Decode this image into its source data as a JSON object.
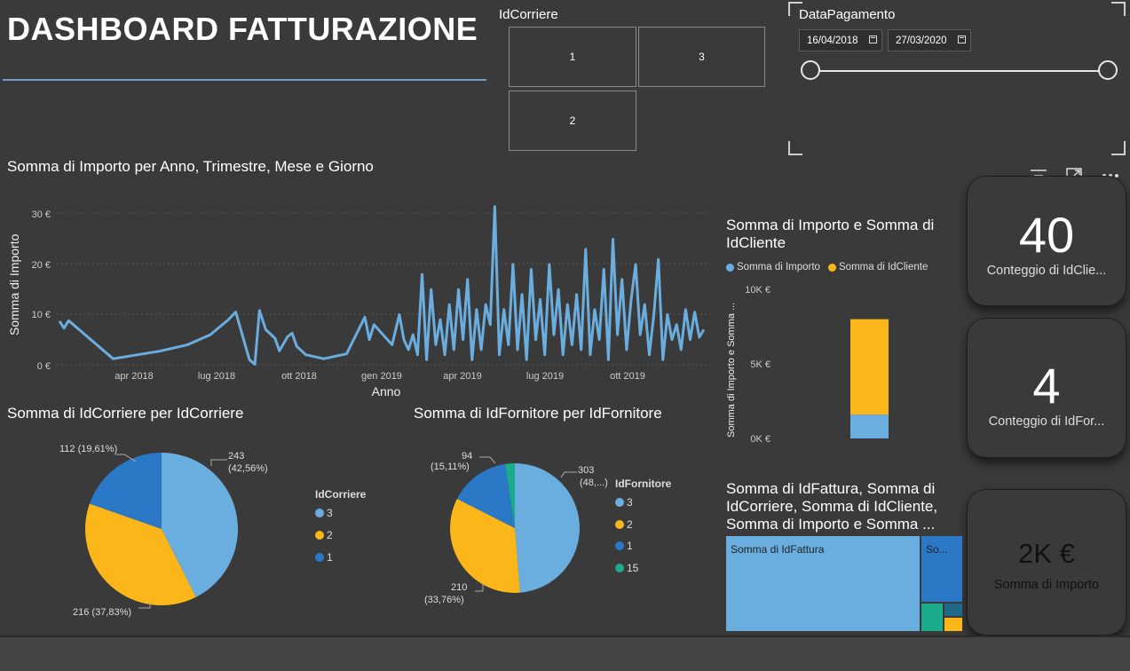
{
  "header": {
    "title": "DASHBOARD FATTURAZIONE"
  },
  "corriere_slicer": {
    "title": "IdCorriere",
    "tiles": [
      "1",
      "3",
      "2"
    ]
  },
  "date_slicer": {
    "title": "DataPagamento",
    "start": "16/04/2018",
    "end": "27/03/2020",
    "range_fraction": [
      0,
      1
    ]
  },
  "line_chart": {
    "title": "Somma di Importo per Anno, Trimestre, Mese e Giorno",
    "xlabel": "Anno",
    "ylabel": "Somma di Importo",
    "y_ticks": [
      "30 €",
      "20 €",
      "10 €",
      "0 €"
    ],
    "x_ticks": [
      "apr 2018",
      "lug 2018",
      "ott 2018",
      "gen 2019",
      "apr 2019",
      "lug 2019",
      "ott 2019"
    ]
  },
  "stacked_chart": {
    "title_line1": "Somma di Importo e Somma di",
    "title_line2": "IdCliente",
    "legend": [
      "Somma di Importo",
      "Somma di IdCliente"
    ],
    "ylabel": "Somma di Importo e Somma ...",
    "y_ticks": [
      "10K €",
      "5K €",
      "0K €"
    ]
  },
  "card_clienti": {
    "value": "40",
    "label": "Conteggio di IdClie..."
  },
  "card_fornitori": {
    "value": "4",
    "label": "Conteggio di IdFor..."
  },
  "card_importo": {
    "value": "2K €",
    "label": "Somma di Importo"
  },
  "pie_corriere": {
    "title": "Somma di IdCorriere per IdCorriere",
    "legend_title": "IdCorriere",
    "legend": [
      "3",
      "2",
      "1"
    ],
    "labels": [
      "243",
      "(42,56%)",
      "216 (37,83%)",
      "112 (19,61%)"
    ]
  },
  "pie_fornitore": {
    "title": "Somma di IdFornitore per IdFornitore",
    "legend_title": "IdFornitore",
    "legend": [
      "3",
      "2",
      "1",
      "15"
    ],
    "labels": [
      "303",
      "(48,...)",
      "210",
      "(33,76%)",
      "94",
      "(15,11%)"
    ]
  },
  "treemap": {
    "title_line1": "Somma di IdFattura, Somma di",
    "title_line2": "IdCorriere, Somma di IdCliente,",
    "title_line3": "Somma di Importo e Somma ...",
    "label_main": "Somma di IdFattura",
    "label_second": "So..."
  },
  "colors": {
    "light_blue": "#6aaee0",
    "yellow": "#fbb719",
    "dark_blue": "#2a78c6",
    "teal": "#1aab8b",
    "background": "#3a3a3a"
  },
  "chart_data": [
    {
      "type": "line",
      "title": "Somma di Importo per Anno, Trimestre, Mese e Giorno",
      "xlabel": "Anno",
      "ylabel": "Somma di Importo",
      "ylim": [
        0,
        32
      ],
      "x_range": [
        "2018-01-15",
        "2019-12-31"
      ],
      "series": [
        {
          "points": [
            [
              "2018-01-16",
              8.7
            ],
            [
              "2018-01-21",
              7.3
            ],
            [
              "2018-01-26",
              8.8
            ],
            [
              "2018-03-16",
              1.2
            ],
            [
              "2018-05-06",
              2.7
            ],
            [
              "2018-06-06",
              4.0
            ],
            [
              "2018-07-01",
              6.0
            ],
            [
              "2018-07-21",
              9.0
            ],
            [
              "2018-07-29",
              10.5
            ],
            [
              "2018-08-13",
              1.0
            ],
            [
              "2018-08-19",
              0.1
            ],
            [
              "2018-08-24",
              10.8
            ],
            [
              "2018-08-31",
              7.0
            ],
            [
              "2018-09-10",
              5.3
            ],
            [
              "2018-09-15",
              2.8
            ],
            [
              "2018-09-24",
              5.6
            ],
            [
              "2018-09-29",
              6.3
            ],
            [
              "2018-10-04",
              3.7
            ],
            [
              "2018-10-14",
              2.0
            ],
            [
              "2018-11-03",
              1.2
            ],
            [
              "2018-11-28",
              2.2
            ],
            [
              "2018-12-18",
              9.5
            ],
            [
              "2018-12-23",
              5.0
            ],
            [
              "2018-12-28",
              8.0
            ],
            [
              "2019-01-17",
              4.0
            ],
            [
              "2019-01-25",
              10.0
            ],
            [
              "2019-01-30",
              5.0
            ],
            [
              "2019-02-04",
              3.0
            ],
            [
              "2019-02-09",
              6.0
            ],
            [
              "2019-02-14",
              2.0
            ],
            [
              "2019-02-19",
              18.0
            ],
            [
              "2019-02-24",
              1.0
            ],
            [
              "2019-03-01",
              15.0
            ],
            [
              "2019-03-06",
              4.0
            ],
            [
              "2019-03-11",
              9.0
            ],
            [
              "2019-03-16",
              2.0
            ],
            [
              "2019-03-21",
              12.0
            ],
            [
              "2019-03-26",
              3.0
            ],
            [
              "2019-03-31",
              15.0
            ],
            [
              "2019-04-05",
              5.0
            ],
            [
              "2019-04-10",
              17.0
            ],
            [
              "2019-04-15",
              1.0
            ],
            [
              "2019-04-20",
              11.0
            ],
            [
              "2019-04-25",
              3.0
            ],
            [
              "2019-04-30",
              12.0
            ],
            [
              "2019-05-05",
              8.0
            ],
            [
              "2019-05-10",
              31.5
            ],
            [
              "2019-05-15",
              2.0
            ],
            [
              "2019-05-20",
              11.0
            ],
            [
              "2019-05-25",
              4.0
            ],
            [
              "2019-05-30",
              20.0
            ],
            [
              "2019-06-04",
              3.0
            ],
            [
              "2019-06-09",
              14.0
            ],
            [
              "2019-06-14",
              1.0
            ],
            [
              "2019-06-19",
              19.0
            ],
            [
              "2019-06-24",
              5.0
            ],
            [
              "2019-06-29",
              13.0
            ],
            [
              "2019-07-04",
              2.0
            ],
            [
              "2019-07-09",
              20.0
            ],
            [
              "2019-07-14",
              6.0
            ],
            [
              "2019-07-19",
              15.0
            ],
            [
              "2019-07-24",
              2.0
            ],
            [
              "2019-07-29",
              12.0
            ],
            [
              "2019-08-03",
              4.0
            ],
            [
              "2019-08-08",
              14.0
            ],
            [
              "2019-08-13",
              3.0
            ],
            [
              "2019-08-18",
              23.0
            ],
            [
              "2019-08-23",
              2.0
            ],
            [
              "2019-08-28",
              11.0
            ],
            [
              "2019-09-02",
              5.0
            ],
            [
              "2019-09-07",
              19.0
            ],
            [
              "2019-09-12",
              1.0
            ],
            [
              "2019-09-17",
              25.0
            ],
            [
              "2019-09-22",
              6.0
            ],
            [
              "2019-09-27",
              17.0
            ],
            [
              "2019-10-02",
              3.0
            ],
            [
              "2019-10-07",
              13.0
            ],
            [
              "2019-10-12",
              20.0
            ],
            [
              "2019-10-17",
              6.0
            ],
            [
              "2019-10-22",
              12.0
            ],
            [
              "2019-10-27",
              2.0
            ],
            [
              "2019-11-01",
              10.0
            ],
            [
              "2019-11-06",
              21.0
            ],
            [
              "2019-11-11",
              1.0
            ],
            [
              "2019-11-16",
              10.0
            ],
            [
              "2019-11-21",
              5.0
            ],
            [
              "2019-11-26",
              8.0
            ],
            [
              "2019-12-01",
              3.0
            ],
            [
              "2019-12-06",
              11.0
            ],
            [
              "2019-12-11",
              5.0
            ],
            [
              "2019-12-16",
              10.5
            ],
            [
              "2019-12-21",
              5.5
            ],
            [
              "2019-12-26",
              7.0
            ]
          ]
        }
      ]
    },
    {
      "type": "bar",
      "stacked": true,
      "title": "Somma di Importo e Somma di IdCliente",
      "ylabel": "Somma di Importo e Somma ...",
      "ylim": [
        0,
        10000
      ],
      "series": [
        {
          "name": "Somma di Importo",
          "values": [
            1600
          ]
        },
        {
          "name": "Somma di IdCliente",
          "values": [
            6400
          ]
        }
      ]
    },
    {
      "type": "pie",
      "title": "Somma di IdCorriere per IdCorriere",
      "categories": [
        "3",
        "2",
        "1"
      ],
      "values": [
        243,
        216,
        112
      ],
      "percentages": [
        42.56,
        37.83,
        19.61
      ]
    },
    {
      "type": "pie",
      "title": "Somma di IdFornitore per IdFornitore",
      "categories": [
        "3",
        "2",
        "1",
        "15"
      ],
      "values": [
        303,
        210,
        94,
        15
      ]
    }
  ]
}
